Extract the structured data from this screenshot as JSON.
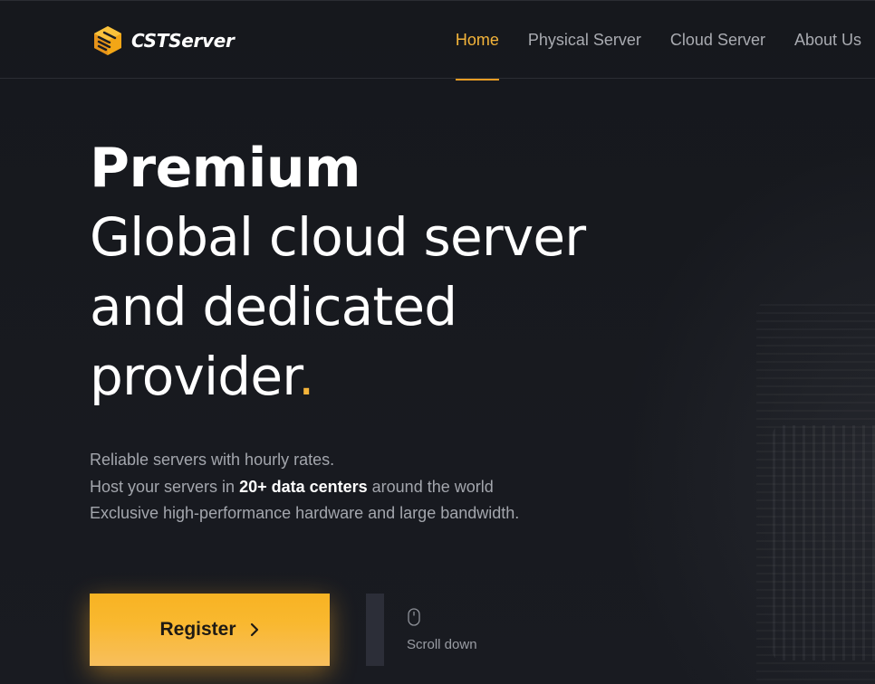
{
  "header": {
    "logo_text": "CSTServer",
    "nav": [
      {
        "label": "Home",
        "active": true
      },
      {
        "label": "Physical Server",
        "active": false
      },
      {
        "label": "Cloud Server",
        "active": false
      },
      {
        "label": "About Us",
        "active": false
      }
    ]
  },
  "hero": {
    "title_bold": "Premium",
    "title_lines": [
      "Global cloud server",
      "and dedicated",
      "provider"
    ],
    "title_end_mark": ".",
    "description": {
      "line1": "Reliable servers with hourly rates.",
      "line2_prefix": "Host your servers in ",
      "line2_highlight": "20+ data centers",
      "line2_suffix": " around the world",
      "line3": "Exclusive high-performance hardware and large bandwidth."
    }
  },
  "actions": {
    "register_label": "Register",
    "register_icon": "chevron-right-icon",
    "scroll_icon": "mouse-icon",
    "scroll_label": "Scroll down"
  },
  "colors": {
    "background": "#17191f",
    "accent": "#f4b43a",
    "button": "#f7b323",
    "nav_inactive": "#a9abb1"
  }
}
